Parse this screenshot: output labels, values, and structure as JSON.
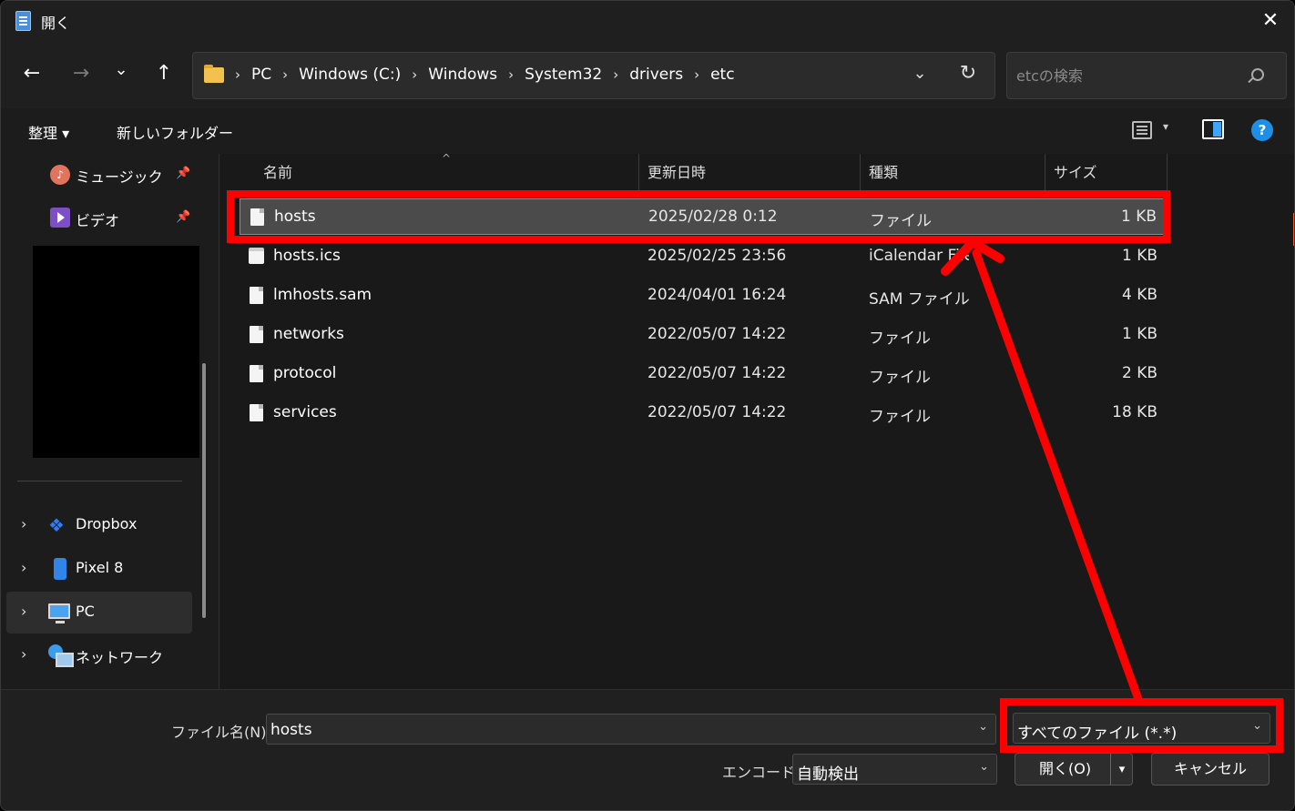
{
  "window": {
    "title": "開く",
    "close_glyph": "✕"
  },
  "nav": {
    "back_glyph": "←",
    "forward_glyph": "→",
    "recent_glyph": "⌄",
    "up_glyph": "↑",
    "breadcrumbs": [
      "PC",
      "Windows (C:)",
      "Windows",
      "System32",
      "drivers",
      "etc"
    ],
    "separator": "›",
    "dropdown_glyph": "⌄",
    "refresh_glyph": "↻",
    "search_placeholder": "etcの検索"
  },
  "commands": {
    "organize": "整理 ▾",
    "new_folder": "新しいフォルダー",
    "view_dropdown": "▾",
    "help": "?"
  },
  "sidebar": {
    "pin_glyph": "📌",
    "chevron": "›",
    "quick_access": [
      {
        "label": "ミュージック",
        "icon": "music-icon",
        "note": "♪"
      },
      {
        "label": "ビデオ",
        "icon": "video-icon"
      }
    ],
    "locations": [
      {
        "label": "Dropbox",
        "icon": "dropbox-icon",
        "glyph": "❖"
      },
      {
        "label": "Pixel 8",
        "icon": "phone-icon"
      },
      {
        "label": "PC",
        "icon": "pc-icon",
        "selected": true
      },
      {
        "label": "ネットワーク",
        "icon": "network-icon"
      }
    ]
  },
  "file_list": {
    "sort_glyph": "^",
    "columns": {
      "name": "名前",
      "modified": "更新日時",
      "type": "種類",
      "size": "サイズ"
    },
    "rows": [
      {
        "name": "hosts",
        "modified": "2025/02/28 0:12",
        "type": "ファイル",
        "size": "1 KB",
        "selected": true
      },
      {
        "name": "hosts.ics",
        "modified": "2025/02/25 23:56",
        "type": "iCalendar File",
        "size": "1 KB"
      },
      {
        "name": "lmhosts.sam",
        "modified": "2024/04/01 16:24",
        "type": "SAM ファイル",
        "size": "4 KB"
      },
      {
        "name": "networks",
        "modified": "2022/05/07 14:22",
        "type": "ファイル",
        "size": "1 KB"
      },
      {
        "name": "protocol",
        "modified": "2022/05/07 14:22",
        "type": "ファイル",
        "size": "2 KB"
      },
      {
        "name": "services",
        "modified": "2022/05/07 14:22",
        "type": "ファイル",
        "size": "18 KB"
      }
    ]
  },
  "footer": {
    "filename_label": "ファイル名(N):",
    "filename_value": "hosts",
    "filetype_value": "すべてのファイル (*.*)",
    "encoding_label": "エンコード:",
    "encoding_value": "自動検出",
    "open_button": "開く(O)",
    "cancel_button": "キャンセル",
    "dropdown_glyph": "⌄",
    "split_glyph": "▾"
  },
  "annotation": {
    "color": "#ff0000"
  }
}
